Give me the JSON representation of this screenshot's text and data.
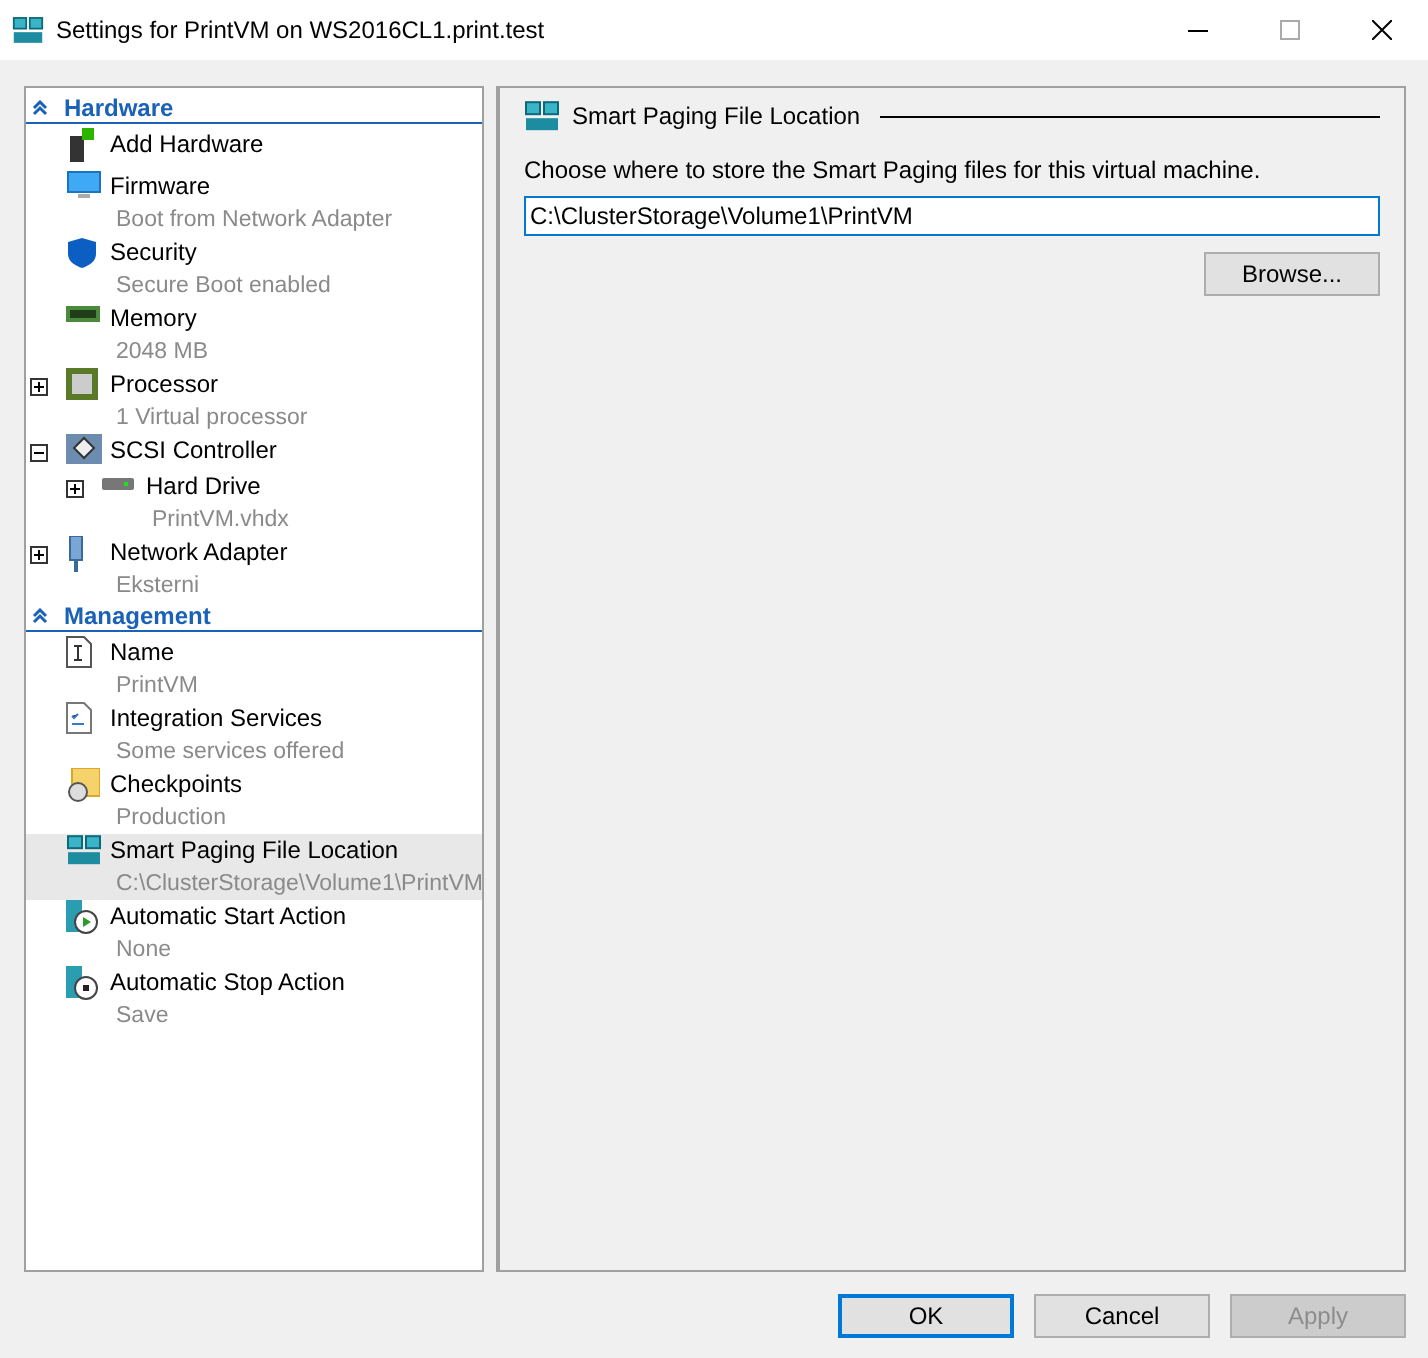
{
  "window": {
    "title": "Settings for PrintVM on WS2016CL1.print.test"
  },
  "tree": [
    {
      "heading": "Hardware",
      "items": [
        {
          "label": "Add Hardware",
          "selected": false
        },
        {
          "label": "Firmware",
          "detail": "Boot from Network Adapter",
          "selected": false
        },
        {
          "label": "Security",
          "detail": "Secure Boot enabled",
          "selected": false
        },
        {
          "label": "Memory",
          "detail": "2048 MB",
          "selected": false
        },
        {
          "label": "Processor",
          "detail": "1 Virtual processor",
          "expanded": false,
          "selected": false
        },
        {
          "label": "SCSI Controller",
          "expanded": true,
          "selected": false,
          "children": [
            {
              "label": "Hard Drive",
              "detail": "PrintVM.vhdx",
              "expanded": false,
              "selected": false
            }
          ]
        },
        {
          "label": "Network Adapter",
          "detail": "Eksterni",
          "expanded": false,
          "selected": false
        }
      ]
    },
    {
      "heading": "Management",
      "items": [
        {
          "label": "Name",
          "detail": "PrintVM",
          "selected": false
        },
        {
          "label": "Integration Services",
          "detail": "Some services offered",
          "selected": false
        },
        {
          "label": "Checkpoints",
          "detail": "Production",
          "selected": false
        },
        {
          "label": "Smart Paging File Location",
          "detail": "C:\\ClusterStorage\\Volume1\\PrintVM",
          "selected": true
        },
        {
          "label": "Automatic Start Action",
          "detail": "None",
          "selected": false
        },
        {
          "label": "Automatic Stop Action",
          "detail": "Save",
          "selected": false
        }
      ]
    }
  ],
  "panel": {
    "title": "Smart Paging File Location",
    "description": "Choose where to store the Smart Paging files for this virtual machine.",
    "path": "C:\\ClusterStorage\\Volume1\\PrintVM",
    "browse": "Browse..."
  },
  "buttons": [
    {
      "label": "OK",
      "default": true,
      "disabled": false
    },
    {
      "label": "Cancel",
      "default": false,
      "disabled": false
    },
    {
      "label": "Apply",
      "default": false,
      "disabled": true
    }
  ]
}
